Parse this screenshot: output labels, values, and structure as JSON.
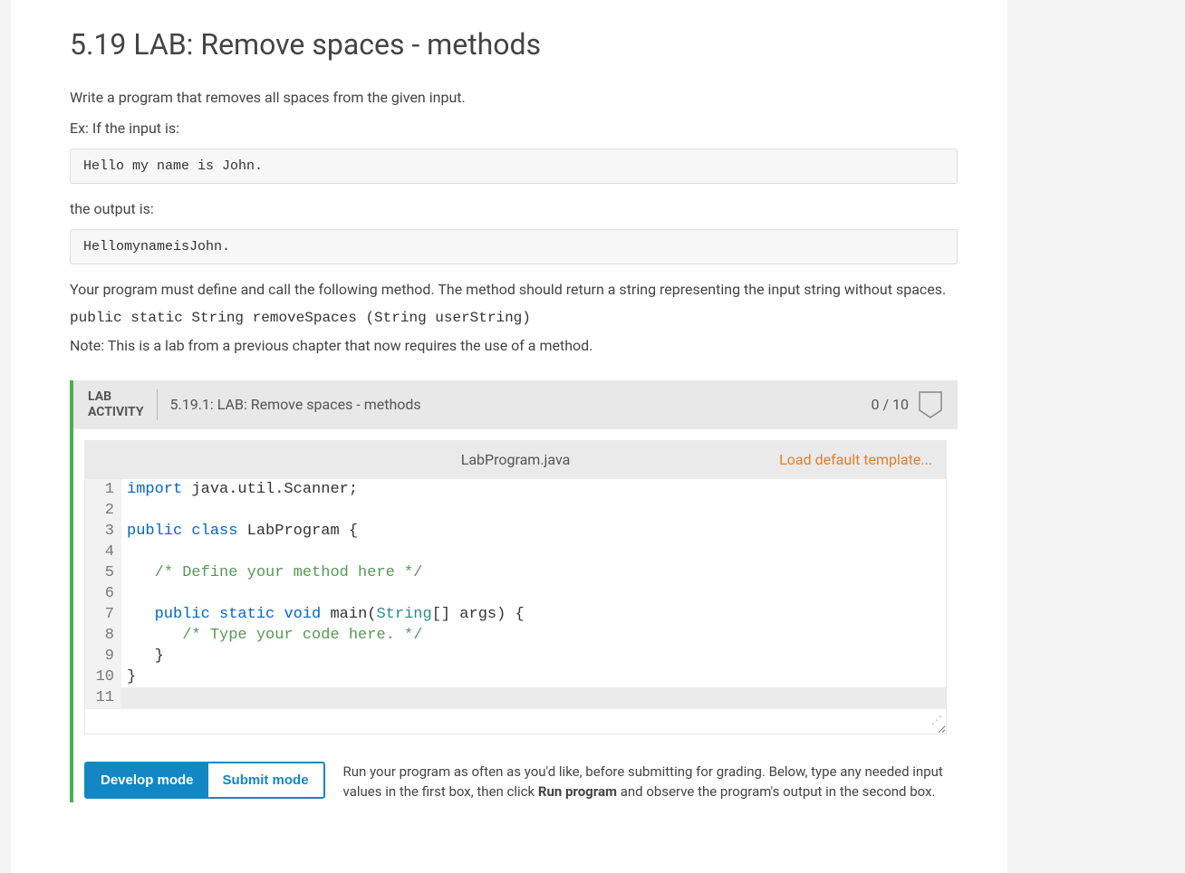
{
  "page": {
    "title": "5.19 LAB: Remove spaces - methods",
    "intro": "Write a program that removes all spaces from the given input.",
    "ex_label": "Ex: If the input is:",
    "ex_input": "Hello my name is John.",
    "output_label": "the output is:",
    "ex_output": "HellomynameisJohn.",
    "method_desc": "Your program must define and call the following method. The method should return a string representing the input string without spaces.",
    "method_sig": "public static String removeSpaces (String userString)",
    "note": "Note: This is a lab from a previous chapter that now requires the use of a method."
  },
  "lab": {
    "label_line1": "LAB",
    "label_line2": "ACTIVITY",
    "title": "5.19.1: LAB: Remove spaces - methods",
    "score": "0 / 10",
    "filename": "LabProgram.java",
    "load_template": "Load default template...",
    "code_lines": [
      {
        "n": "1",
        "tokens": [
          {
            "t": "import",
            "c": "kw-import"
          },
          {
            "t": " java.util.Scanner;",
            "c": "ident"
          }
        ]
      },
      {
        "n": "2",
        "tokens": []
      },
      {
        "n": "3",
        "tokens": [
          {
            "t": "public",
            "c": "kw"
          },
          {
            "t": " ",
            "c": ""
          },
          {
            "t": "class",
            "c": "kw"
          },
          {
            "t": " LabProgram {",
            "c": "ident"
          }
        ]
      },
      {
        "n": "4",
        "tokens": []
      },
      {
        "n": "5",
        "tokens": [
          {
            "t": "   ",
            "c": ""
          },
          {
            "t": "/* Define your method here */",
            "c": "comment"
          }
        ]
      },
      {
        "n": "6",
        "tokens": []
      },
      {
        "n": "7",
        "tokens": [
          {
            "t": "   ",
            "c": ""
          },
          {
            "t": "public",
            "c": "kw"
          },
          {
            "t": " ",
            "c": ""
          },
          {
            "t": "static",
            "c": "kw"
          },
          {
            "t": " ",
            "c": ""
          },
          {
            "t": "void",
            "c": "kw"
          },
          {
            "t": " main(",
            "c": "ident"
          },
          {
            "t": "String",
            "c": "type"
          },
          {
            "t": "[] args) {",
            "c": "ident"
          }
        ]
      },
      {
        "n": "8",
        "tokens": [
          {
            "t": "      ",
            "c": ""
          },
          {
            "t": "/* Type your code here. */",
            "c": "comment"
          }
        ]
      },
      {
        "n": "9",
        "tokens": [
          {
            "t": "   }",
            "c": "ident"
          }
        ]
      },
      {
        "n": "10",
        "tokens": [
          {
            "t": "}",
            "c": "ident"
          }
        ]
      },
      {
        "n": "11",
        "tokens": [],
        "current": true
      }
    ]
  },
  "modes": {
    "develop": "Develop mode",
    "submit": "Submit mode",
    "help_prefix": "Run your program as often as you'd like, before submitting for grading. Below, type any needed input values in the first box, then click ",
    "help_bold": "Run program",
    "help_suffix": " and observe the program's output in the second box."
  }
}
